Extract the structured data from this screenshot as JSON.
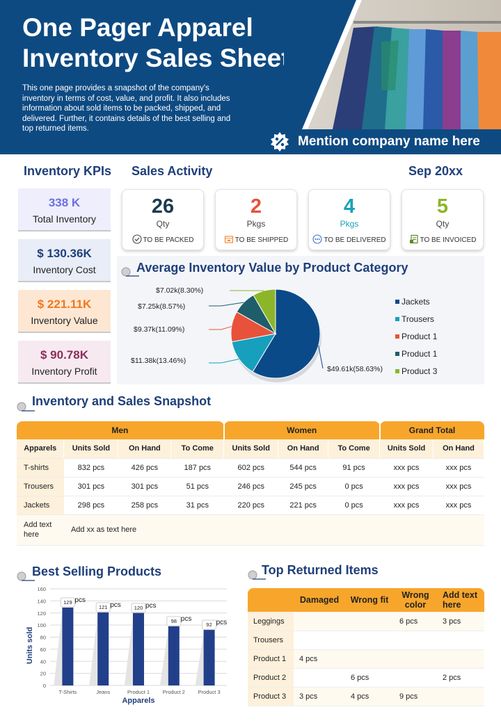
{
  "header": {
    "title": "One Pager Apparel Inventory Sales Sheet",
    "description": "This one page provides a snapshot of the company's inventory in terms of cost, value, and profit. It also includes information about sold items to be packed, shipped, and delivered. Further, it contains details of the best selling and top returned items.",
    "company": "Mention company name here"
  },
  "sections": {
    "kpis": "Inventory KPIs",
    "activity": "Sales Activity",
    "date": "Sep 20xx",
    "avg_chart": "Average Inventory Value by Product Category",
    "snapshot": "Inventory and Sales Snapshot",
    "best": "Best Selling Products",
    "returned": "Top Returned Items"
  },
  "kpis": [
    {
      "value": "338 K",
      "label": "Total Inventory",
      "color": "#6b6fe0",
      "bg": "#eeeefc"
    },
    {
      "value": "$ 130.36K",
      "label": "Inventory Cost",
      "color": "#1f3f7a",
      "bg": "#e8edf7"
    },
    {
      "value": "$ 221.11K",
      "label": "Inventory Value",
      "color": "#f0781e",
      "bg": "#fde7d3"
    },
    {
      "value": "$ 90.78K",
      "label": "Inventory Profit",
      "color": "#8b2f5a",
      "bg": "#f6eaf0"
    }
  ],
  "activity": [
    {
      "number": "26",
      "unit": "Qty",
      "status": "TO BE PACKED",
      "color": "#1e3b4f",
      "unit_color": "#444444",
      "icon": "check-circle-icon"
    },
    {
      "number": "2",
      "unit": "Pkgs",
      "status": "TO BE SHIPPED",
      "color": "#e8523a",
      "unit_color": "#444444",
      "icon": "package-icon"
    },
    {
      "number": "4",
      "unit": "Pkgs",
      "status": "TO BE DELIVERED",
      "color": "#1aa3b8",
      "unit_color": "#1aa3b8",
      "icon": "dots-circle-icon"
    },
    {
      "number": "5",
      "unit": "Qty",
      "status": "TO BE INVOICED",
      "color": "#8db52a",
      "unit_color": "#444444",
      "icon": "invoice-icon"
    }
  ],
  "chart_data": [
    {
      "type": "pie",
      "title": "Average Inventory Value by Product Category",
      "categories": [
        "Jackets",
        "Trousers",
        "Product 1",
        "Product 1",
        "Product 3"
      ],
      "values": [
        49.61,
        11.38,
        9.37,
        7.25,
        7.02
      ],
      "labels": [
        "$49.61k(58.63%)",
        "$11.38k(13.46%)",
        "$9.37k(11.09%)",
        "$7.25k(8.57%)",
        "$7.02k(8.30%)"
      ],
      "colors": [
        "#0b4a88",
        "#17a0bd",
        "#e8523a",
        "#1d5e6a",
        "#8db52a"
      ],
      "legend": "right"
    },
    {
      "type": "bar",
      "title": "Best Selling Products",
      "categories": [
        "T-Shirts",
        "Jeans",
        "Product 1",
        "Product 2",
        "Product 3"
      ],
      "values": [
        129,
        121,
        120,
        98,
        92
      ],
      "value_labels": [
        "129",
        "121",
        "120",
        "98",
        "92"
      ],
      "value_unit": "pcs",
      "xlabel": "Apparels",
      "ylabel": "Units sold",
      "ylim": [
        0,
        160
      ],
      "yticks": [
        "0",
        "20",
        "40",
        "60",
        "80",
        "100",
        "120",
        "140",
        "160"
      ],
      "grid": true,
      "color": "#223f8a"
    }
  ],
  "snapshot": {
    "groups": [
      "Men",
      "Women",
      "Grand Total"
    ],
    "columns": [
      "Apparels",
      "Units Sold",
      "On Hand",
      "To Come",
      "Units Sold",
      "On Hand",
      "To Come",
      "Units Sold",
      "On Hand"
    ],
    "rows": [
      [
        "T-shirts",
        "832 pcs",
        "426 pcs",
        "187 pcs",
        "602 pcs",
        "544 pcs",
        "91 pcs",
        "xxx pcs",
        "xxx pcs"
      ],
      [
        "Trousers",
        "301 pcs",
        "301 pcs",
        "51 pcs",
        "246 pcs",
        "245 pcs",
        "0 pcs",
        "xxx pcs",
        "xxx pcs"
      ],
      [
        "Jackets",
        "298 pcs",
        "258 pcs",
        "31 pcs",
        "220 pcs",
        "221 pcs",
        "0 pcs",
        "xxx pcs",
        "xxx pcs"
      ]
    ],
    "footer_label": "Add text here",
    "footer_text": "Add xx as text here"
  },
  "returned": {
    "columns": [
      "",
      "Damaged",
      "Wrong fit",
      "Wrong color",
      "Add text here"
    ],
    "rows": [
      [
        "Leggings",
        "",
        "",
        "6 pcs",
        "3 pcs"
      ],
      [
        "Trousers",
        "",
        "",
        "",
        ""
      ],
      [
        "Product 1",
        "4 pcs",
        "",
        "",
        ""
      ],
      [
        "Product 2",
        "",
        "6 pcs",
        "",
        "2 pcs"
      ],
      [
        "Product 3",
        "3 pcs",
        "4 pcs",
        "9 pcs",
        ""
      ]
    ]
  }
}
